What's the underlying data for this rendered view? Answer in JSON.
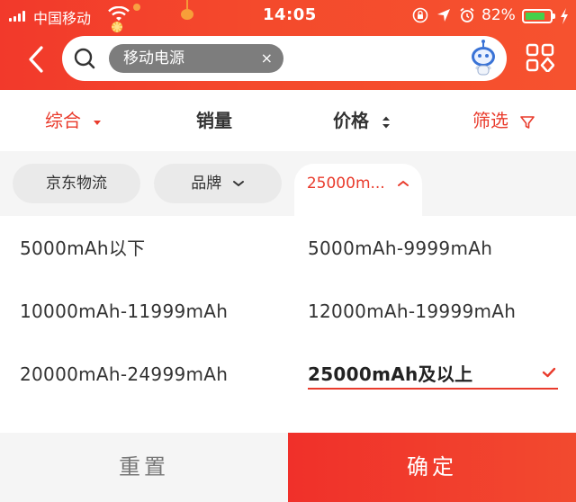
{
  "status_bar": {
    "carrier": "中国移动",
    "time": "14:05",
    "battery": "82%",
    "battery_level": 0.82
  },
  "search": {
    "keyword": "移动电源",
    "clear_glyph": "×"
  },
  "sort_bar": {
    "comprehensive": "综合",
    "sales": "销量",
    "price": "价格",
    "filter": "筛选"
  },
  "filter_chips": [
    {
      "label": "京东物流"
    },
    {
      "label": "品牌"
    },
    {
      "label": "25000m..."
    }
  ],
  "capacity_options": [
    {
      "label": "5000mAh以下",
      "selected": false
    },
    {
      "label": "5000mAh-9999mAh",
      "selected": false
    },
    {
      "label": "10000mAh-11999mAh",
      "selected": false
    },
    {
      "label": "12000mAh-19999mAh",
      "selected": false
    },
    {
      "label": "20000mAh-24999mAh",
      "selected": false
    },
    {
      "label": "25000mAh及以上",
      "selected": true
    }
  ],
  "actions": {
    "reset": "重置",
    "confirm": "确定"
  },
  "colors": {
    "brand_red": "#e93b2c",
    "header_red": "#f2392b",
    "battery_green": "#44d04a"
  },
  "icons": [
    "signal-icon",
    "wifi-icon",
    "orientation-lock-icon",
    "location-icon",
    "alarm-icon",
    "battery-icon",
    "charging-icon",
    "back-arrow-icon",
    "search-icon",
    "robot-assistant-icon",
    "grid-menu-icon",
    "caret-down-icon",
    "sort-updown-icon",
    "funnel-icon",
    "chevron-down-icon",
    "chevron-up-icon",
    "checkmark-icon"
  ]
}
